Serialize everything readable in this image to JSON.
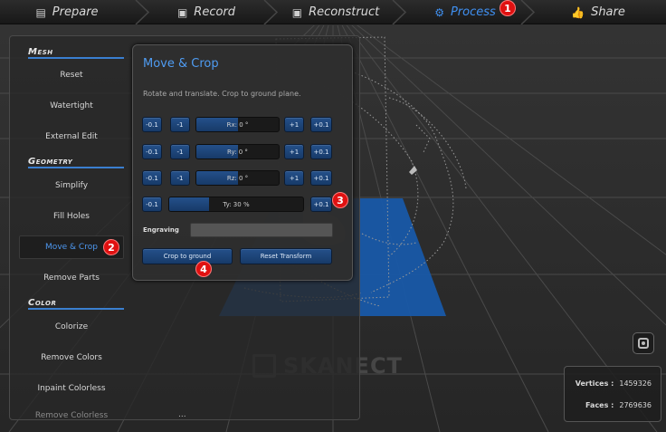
{
  "nav": {
    "tabs": [
      {
        "label": "Prepare",
        "icon": "clipboard-icon"
      },
      {
        "label": "Record",
        "icon": "film-icon"
      },
      {
        "label": "Reconstruct",
        "icon": "cube-icon"
      },
      {
        "label": "Process",
        "icon": "gears-icon"
      },
      {
        "label": "Share",
        "icon": "thumbs-up-icon"
      }
    ],
    "active": "Process",
    "active_color": "#3f8ff0"
  },
  "badges": [
    "1",
    "2",
    "3",
    "4"
  ],
  "sidebar": {
    "sections": [
      {
        "title": "Mesh",
        "items": [
          "Reset",
          "Watertight",
          "External Edit"
        ]
      },
      {
        "title": "Geometry",
        "items": [
          "Simplify",
          "Fill Holes",
          "Move & Crop",
          "Remove Parts"
        ]
      },
      {
        "title": "Color",
        "items": [
          "Colorize",
          "Remove Colors",
          "Inpaint Colorless",
          "Remove Colorless"
        ]
      }
    ],
    "active_item": "Move & Crop",
    "more": "..."
  },
  "dialog": {
    "title": "Move & Crop",
    "description": "Rotate and translate. Crop to ground plane.",
    "rows": [
      {
        "minus_small": "-0.1",
        "minus": "-1",
        "slider": "Rx: 0 °",
        "plus": "+1",
        "plus_small": "+0.1",
        "fill": 0.5
      },
      {
        "minus_small": "-0.1",
        "minus": "-1",
        "slider": "Ry: 0 °",
        "plus": "+1",
        "plus_small": "+0.1",
        "fill": 0.5
      },
      {
        "minus_small": "-0.1",
        "minus": "-1",
        "slider": "Rz: 0 °",
        "plus": "+1",
        "plus_small": "+0.1",
        "fill": 0.5
      }
    ],
    "ty_row": {
      "minus_small": "-0.1",
      "slider": "Ty: 30 %",
      "plus_small": "+0.1",
      "fill": 0.3
    },
    "engraving_label": "Engraving",
    "crop_button": "Crop to ground",
    "reset_button": "Reset Transform"
  },
  "stats": {
    "vertices_label": "Vertices :",
    "vertices_value": "1459326",
    "faces_label": "Faces :",
    "faces_value": "2769636"
  },
  "watermark": "SKANECT",
  "colors": {
    "accent": "#3f8ff0",
    "ground_plane": "#1858a8",
    "badge": "#e01111"
  }
}
